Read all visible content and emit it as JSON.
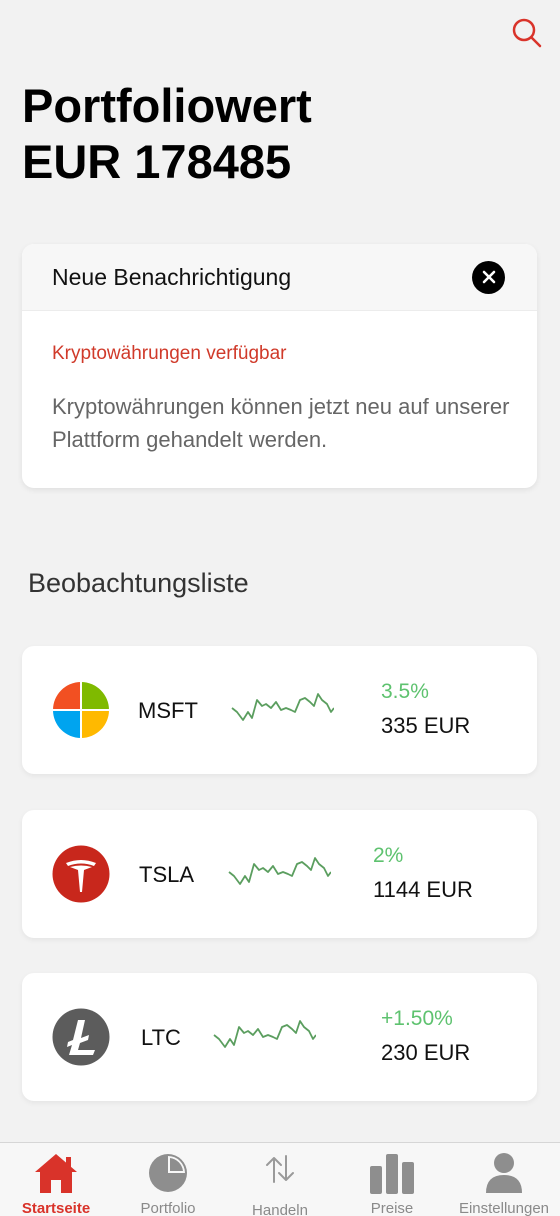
{
  "header": {
    "title_line1": "Portfoliowert",
    "title_line2": "EUR 178485",
    "search_icon": "search-icon"
  },
  "notification": {
    "header": "Neue Benachrichtigung",
    "subtitle": "Kryptowährungen verfügbar",
    "body": "Kryptowährungen können jetzt neu auf unserer Plattform gehandelt werden.",
    "close_icon": "close-icon"
  },
  "watchlist": {
    "title": "Beobachtungsliste",
    "items": [
      {
        "ticker": "MSFT",
        "change": "3.5%",
        "price": "335 EUR",
        "icon": "microsoft-logo-icon"
      },
      {
        "ticker": "TSLA",
        "change": "2%",
        "price": "1144 EUR",
        "icon": "tesla-logo-icon"
      },
      {
        "ticker": "LTC",
        "change": "+1.50%",
        "price": "230 EUR",
        "icon": "litecoin-logo-icon"
      }
    ]
  },
  "tabs": [
    {
      "label": "Startseite",
      "icon": "home-icon",
      "active": true
    },
    {
      "label": "Portfolio",
      "icon": "pie-chart-icon",
      "active": false
    },
    {
      "label": "Handeln",
      "icon": "swap-arrows-icon",
      "active": false
    },
    {
      "label": "Preise",
      "icon": "bar-chart-icon",
      "active": false
    },
    {
      "label": "Einstellungen",
      "icon": "user-icon",
      "active": false
    }
  ],
  "colors": {
    "accent": "#d9332a",
    "positive": "#5ec26f",
    "background": "#f2f2f2"
  }
}
